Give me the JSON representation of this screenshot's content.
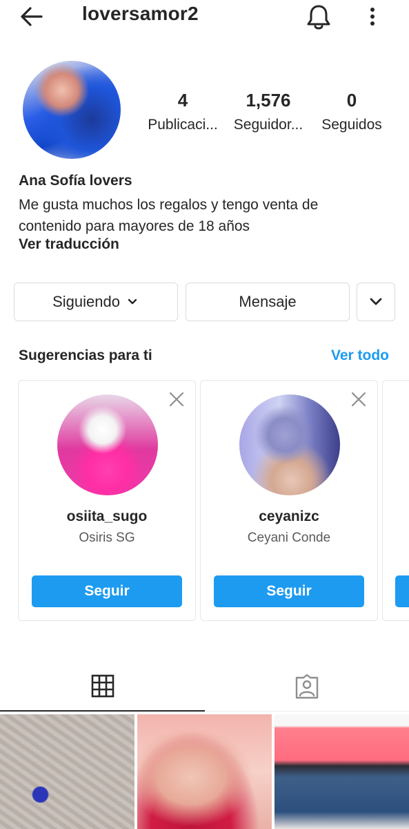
{
  "header": {
    "username": "loversamor2",
    "back_icon": "arrow-left-icon",
    "notify_icon": "bell-icon",
    "more_icon": "more-vertical-icon"
  },
  "profile": {
    "stats": [
      {
        "value": "4",
        "label": "Publicaci..."
      },
      {
        "value": "1,576",
        "label": "Seguidor..."
      },
      {
        "value": "0",
        "label": "Seguidos"
      }
    ],
    "full_name": "Ana Sofía lovers",
    "bio_line1": "Me gusta muchos los regalos y tengo venta de",
    "bio_line2": "contenido para mayores de 18 años",
    "translate_label": "Ver traducción"
  },
  "actions": {
    "following_label": "Siguiendo",
    "message_label": "Mensaje"
  },
  "suggestions": {
    "title": "Sugerencias para ti",
    "see_all": "Ver todo",
    "cards": [
      {
        "username": "osiita_sugo",
        "name": "Osiris SG",
        "follow_label": "Seguir"
      },
      {
        "username": "ceyanizc",
        "name": "Ceyani Conde",
        "follow_label": "Seguir"
      }
    ]
  },
  "tabs": [
    {
      "icon": "grid-icon",
      "selected": true
    },
    {
      "icon": "tagged-user-icon",
      "selected": false
    }
  ],
  "colors": {
    "accent": "#1d9bf0",
    "text": "#262626",
    "border": "#dbdbdb"
  }
}
